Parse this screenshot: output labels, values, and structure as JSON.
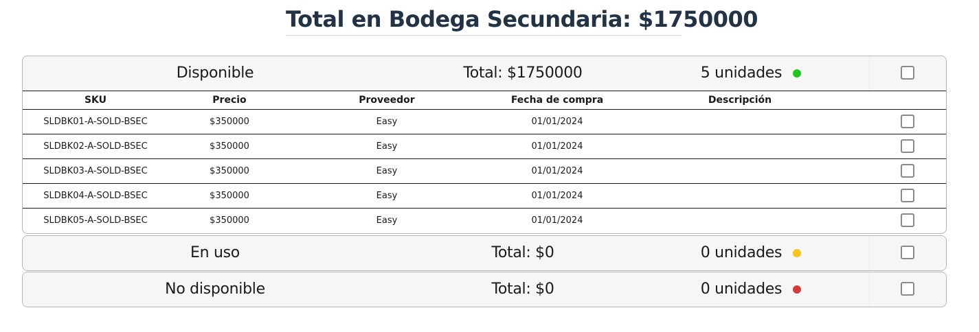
{
  "page": {
    "title": "Total en Bodega Secundaria: $1750000"
  },
  "colors": {
    "available": "#1ec81e",
    "in_use": "#f5c518",
    "unavailable": "#d93b3b"
  },
  "table": {
    "headers": {
      "sku": "SKU",
      "price": "Precio",
      "provider": "Proveedor",
      "purchase_date": "Fecha de compra",
      "description": "Descripción"
    }
  },
  "groups": [
    {
      "status": "Disponible",
      "total": "Total: $1750000",
      "units": "5 unidades",
      "indicator": "green-dot",
      "expanded": true,
      "rows": [
        {
          "sku": "SLDBK01-A-SOLD-BSEC",
          "price": "$350000",
          "provider": "Easy",
          "purchase_date": "01/01/2024",
          "description": ""
        },
        {
          "sku": "SLDBK02-A-SOLD-BSEC",
          "price": "$350000",
          "provider": "Easy",
          "purchase_date": "01/01/2024",
          "description": ""
        },
        {
          "sku": "SLDBK03-A-SOLD-BSEC",
          "price": "$350000",
          "provider": "Easy",
          "purchase_date": "01/01/2024",
          "description": ""
        },
        {
          "sku": "SLDBK04-A-SOLD-BSEC",
          "price": "$350000",
          "provider": "Easy",
          "purchase_date": "01/01/2024",
          "description": ""
        },
        {
          "sku": "SLDBK05-A-SOLD-BSEC",
          "price": "$350000",
          "provider": "Easy",
          "purchase_date": "01/01/2024",
          "description": ""
        }
      ]
    },
    {
      "status": "En uso",
      "total": "Total: $0",
      "units": "0 unidades",
      "indicator": "yellow-dot",
      "expanded": false
    },
    {
      "status": "No disponible",
      "total": "Total: $0",
      "units": "0 unidades",
      "indicator": "red-dot",
      "expanded": false
    }
  ]
}
